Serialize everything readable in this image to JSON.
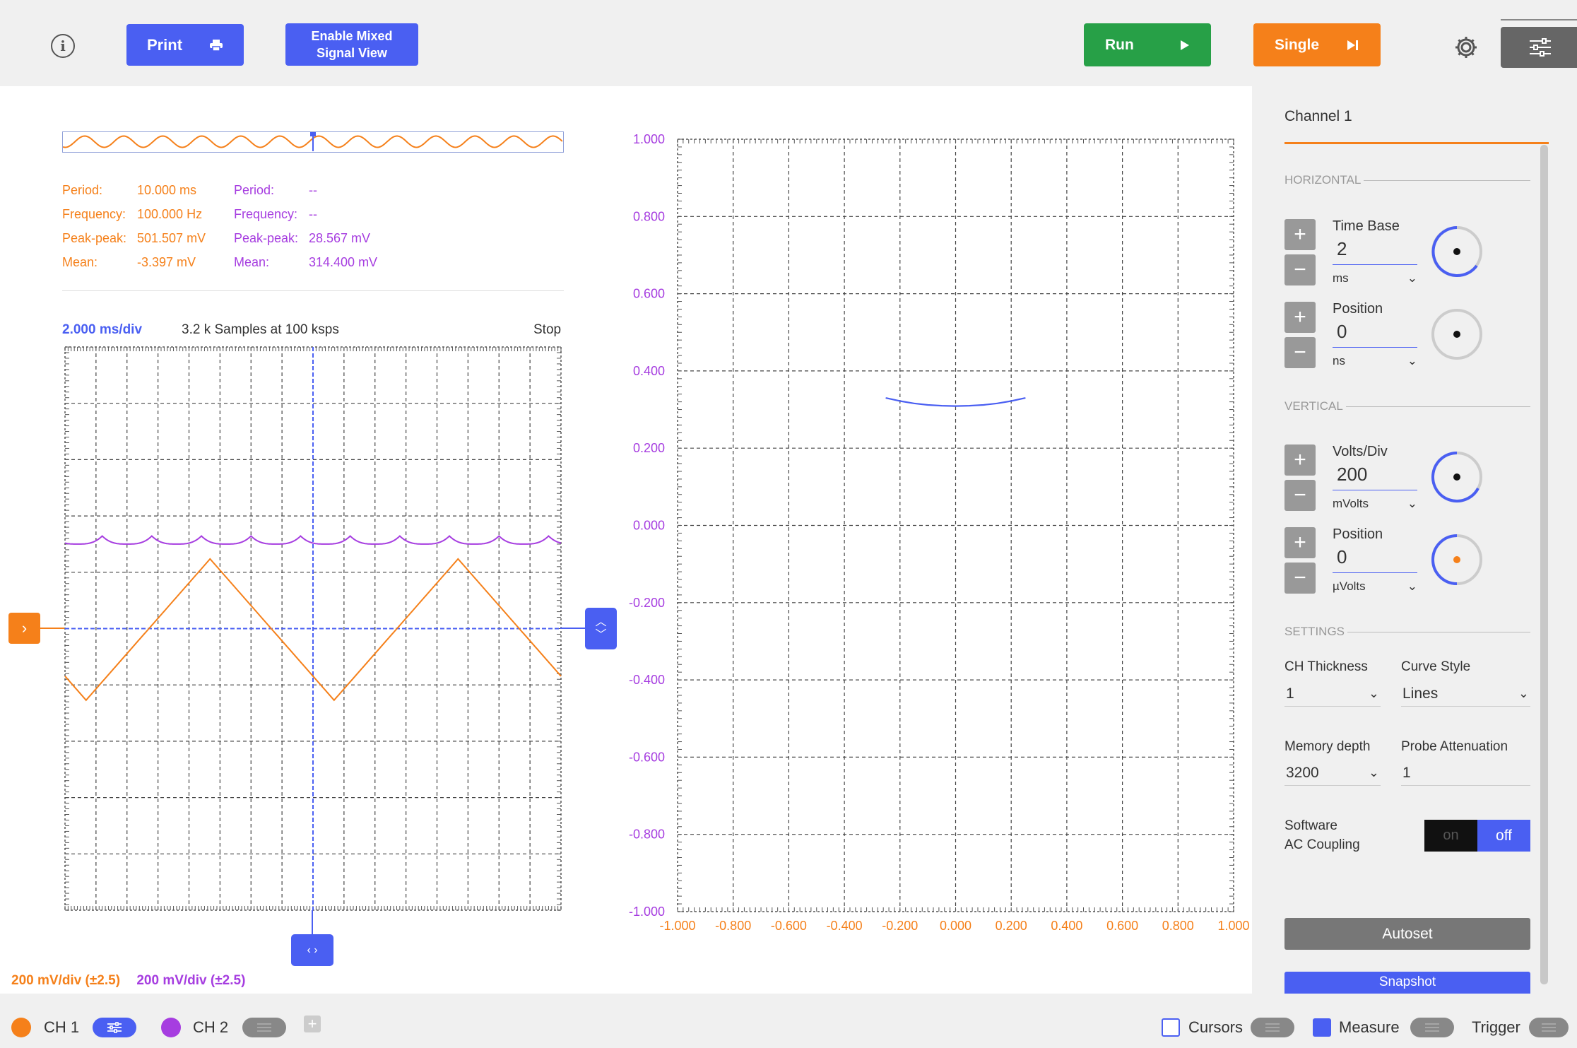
{
  "toolbar": {
    "info_icon": "info-icon",
    "print_label": "Print",
    "print_icon": "printer-icon",
    "mixed_signal_label": "Enable Mixed\nSignal View",
    "run_label": "Run",
    "run_icon": "play-icon",
    "single_label": "Single",
    "single_icon": "skip-next-icon",
    "settings_icon": "gear-icon",
    "menu_icon": "sliders-icon"
  },
  "colors": {
    "ch1": "#f5801a",
    "ch2": "#a63de0",
    "accent": "#4a5ff2",
    "run": "#27a047",
    "single": "#f5801a"
  },
  "measurements": {
    "ch1": {
      "period_label": "Period:",
      "period": "10.000 ms",
      "frequency_label": "Frequency:",
      "frequency": "100.000 Hz",
      "peakpeak_label": "Peak-peak:",
      "peakpeak": "501.507 mV",
      "mean_label": "Mean:",
      "mean": "-3.397 mV"
    },
    "ch2": {
      "period_label": "Period:",
      "period": "--",
      "frequency_label": "Frequency:",
      "frequency": "--",
      "peakpeak_label": "Peak-peak:",
      "peakpeak": "28.567 mV",
      "mean_label": "Mean:",
      "mean": "314.400 mV"
    }
  },
  "time_plot": {
    "timebase": "2.000 ms/div",
    "samples": "3.2 k Samples at 100 ksps",
    "state": "Stop",
    "ch1_scale": "200 mV/div (±2.5)",
    "ch2_scale": "200 mV/div (±2.5)"
  },
  "xy_plot": {
    "y_ticks": [
      "1.000",
      "0.800",
      "0.600",
      "0.400",
      "0.200",
      "0.000",
      "-0.200",
      "-0.400",
      "-0.600",
      "-0.800",
      "-1.000"
    ],
    "x_ticks": [
      "-1.000",
      "-0.800",
      "-0.600",
      "-0.400",
      "-0.200",
      "0.000",
      "0.200",
      "0.400",
      "0.600",
      "0.800",
      "1.000"
    ]
  },
  "chart_data": [
    {
      "type": "line",
      "x_unit": "ms",
      "y_unit": "mV",
      "x_range": [
        0,
        20
      ],
      "y_range": [
        -1000,
        1000
      ],
      "series": [
        {
          "name": "CH 1",
          "waveform": "triangle",
          "period_ms": 10.0,
          "peak_to_peak_mv": 501.507,
          "mean_mv": -3.397
        },
        {
          "name": "CH 2",
          "peak_to_peak_mv": 28.567,
          "mean_mv": 314.4
        }
      ]
    },
    {
      "type": "scatter",
      "xlim": [
        -1.0,
        1.0
      ],
      "ylim": [
        -1.0,
        1.0
      ],
      "x": [
        -0.25,
        -0.2,
        -0.15,
        -0.1,
        -0.05,
        0.0,
        0.05,
        0.1,
        0.15,
        0.2,
        0.25
      ],
      "y": [
        0.33,
        0.322,
        0.316,
        0.312,
        0.31,
        0.309,
        0.31,
        0.312,
        0.316,
        0.322,
        0.33
      ]
    }
  ],
  "panel": {
    "title": "Channel 1",
    "horizontal_header": "HORIZONTAL",
    "timebase_label": "Time Base",
    "timebase_value": "2",
    "timebase_unit": "ms",
    "hpos_label": "Position",
    "hpos_value": "0",
    "hpos_unit": "ns",
    "vertical_header": "VERTICAL",
    "voltsdiv_label": "Volts/Div",
    "voltsdiv_value": "200",
    "voltsdiv_unit": "mVolts",
    "vpos_label": "Position",
    "vpos_value": "0",
    "vpos_unit": "µVolts",
    "settings_header": "SETTINGS",
    "thickness_label": "CH Thickness",
    "thickness_value": "1",
    "curve_label": "Curve Style",
    "curve_value": "Lines",
    "memory_label": "Memory depth",
    "memory_value": "3200",
    "probe_label": "Probe Attenuation",
    "probe_value": "1",
    "ac_label": "Software\nAC Coupling",
    "ac_on": "on",
    "ac_off": "off",
    "autoset_label": "Autoset",
    "snapshot_label": "Snapshot",
    "plus": "+",
    "minus": "−"
  },
  "bottom": {
    "ch1_label": "CH 1",
    "ch2_label": "CH 2",
    "add_channel": "+",
    "cursors_label": "Cursors",
    "measure_label": "Measure",
    "trigger_label": "Trigger"
  }
}
